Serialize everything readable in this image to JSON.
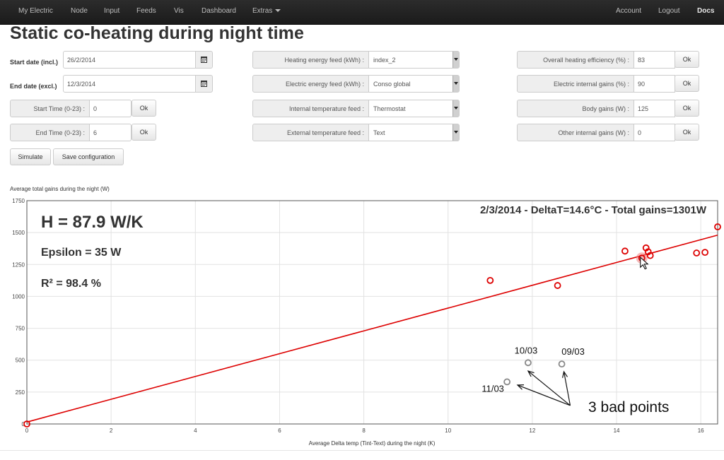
{
  "navbar": {
    "left_items": [
      "My Electric",
      "Node",
      "Input",
      "Feeds",
      "Vis",
      "Dashboard",
      "Extras"
    ],
    "right_items": [
      "Account",
      "Logout",
      "Docs"
    ]
  },
  "page": {
    "title": "Static co-heating during night time"
  },
  "form": {
    "start_date_label": "Start date (incl.)",
    "start_date_value": "26/2/2014",
    "end_date_label": "End date (excl.)",
    "end_date_value": "12/3/2014",
    "start_time_label": "Start Time (0-23) :",
    "start_time_value": "0",
    "end_time_label": "End Time (0-23) :",
    "end_time_value": "6",
    "ok_label": "Ok",
    "simulate_label": "Simulate",
    "save_label": "Save configuration",
    "feeds": [
      {
        "label": "Heating energy feed (kWh) :",
        "value": "index_2"
      },
      {
        "label": "Electric energy feed (kWh) :",
        "value": "Conso global"
      },
      {
        "label": "Internal temperature feed :",
        "value": "Thermostat"
      },
      {
        "label": "External temperature feed :",
        "value": "Text"
      }
    ],
    "params": [
      {
        "label": "Overall heating efficiency (%) :",
        "value": "83"
      },
      {
        "label": "Electric internal gains (%) :",
        "value": "90"
      },
      {
        "label": "Body gains (W) :",
        "value": "125"
      },
      {
        "label": "Other internal gains (W) :",
        "value": "0"
      }
    ]
  },
  "chart_data": {
    "type": "scatter",
    "ylabel": "Average total gains during the night (W)",
    "xlabel": "Average Delta temp (Tint-Text) during the night (K)",
    "xlim": [
      0,
      16.4
    ],
    "ylim": [
      0,
      1750
    ],
    "x_ticks": [
      0,
      2,
      4,
      6,
      8,
      10,
      12,
      14,
      16
    ],
    "y_ticks": [
      0,
      250,
      500,
      750,
      1000,
      1250,
      1500,
      1750
    ],
    "grid": true,
    "series": [
      {
        "color": "#dd0000",
        "points": [
          [
            0,
            0
          ],
          [
            11.0,
            1125
          ],
          [
            12.6,
            1085
          ],
          [
            14.2,
            1355
          ],
          [
            14.6,
            1300
          ],
          [
            14.7,
            1380
          ],
          [
            14.75,
            1350
          ],
          [
            14.8,
            1320
          ],
          [
            15.9,
            1340
          ],
          [
            16.1,
            1345
          ],
          [
            16.4,
            1545
          ]
        ]
      },
      {
        "color": "#888888",
        "points": [
          [
            11.9,
            480
          ],
          [
            12.7,
            470
          ],
          [
            11.4,
            330
          ]
        ]
      }
    ],
    "fit_line": {
      "x": [
        0,
        16.4
      ],
      "y": [
        15,
        1480
      ],
      "color": "#dd0000"
    },
    "highlight": {
      "x": 14.6,
      "y": 1300
    },
    "point_labels": [
      {
        "text": "10/03",
        "x": 11.9,
        "y": 480
      },
      {
        "text": "09/03",
        "x": 12.7,
        "y": 470
      },
      {
        "text": "11/03",
        "x": 11.4,
        "y": 330
      }
    ],
    "annotation_text": "3 bad points",
    "arrow_origin": {
      "x": 12.9,
      "y": 145
    },
    "arrow_targets": [
      [
        11.9,
        415
      ],
      [
        12.75,
        410
      ],
      [
        11.65,
        305
      ]
    ],
    "stats": {
      "h": "H = 87.9 W/K",
      "epsilon": "Epsilon = 35 W",
      "r2": "R² = 98.4 %"
    },
    "info": "2/3/2014 - DeltaT=14.6°C - Total gains=1301W"
  },
  "colors": {
    "navbar": "#1b1b1b",
    "fit_line": "#dd0000",
    "bad_points": "#888888"
  },
  "icons": {
    "calendar": "calendar-icon",
    "cursor": "cursor-icon"
  }
}
